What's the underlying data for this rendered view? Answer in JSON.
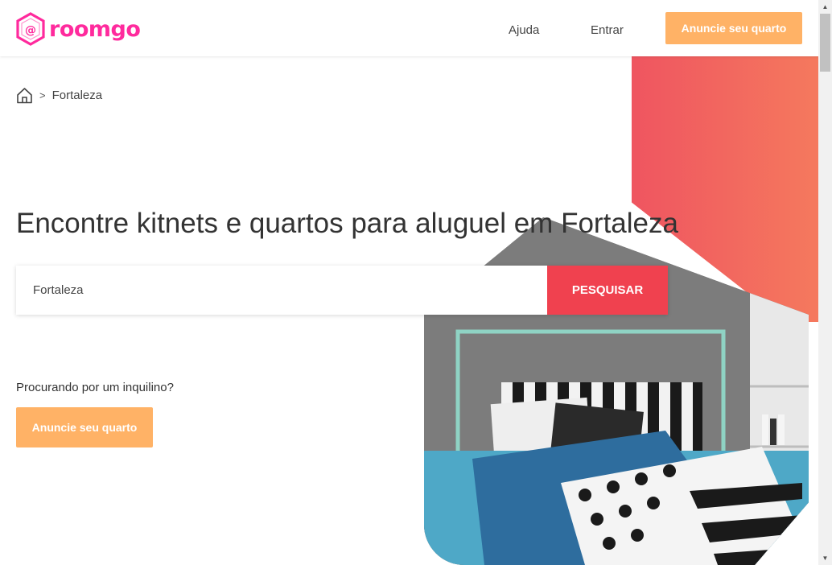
{
  "header": {
    "logo_text": "roomgo",
    "nav": {
      "help": "Ajuda",
      "login": "Entrar"
    },
    "cta_label": "Anuncie seu quarto"
  },
  "breadcrumb": {
    "separator": ">",
    "current": "Fortaleza",
    "home_icon": "home-icon"
  },
  "hero": {
    "title": "Encontre kitnets e quartos para aluguel em Fortaleza",
    "search": {
      "value": "Fortaleza",
      "button_label": "PESQUISAR"
    },
    "tenant_prompt": "Procurando por um inquilino?",
    "tenant_cta": "Anuncie seu quarto"
  },
  "colors": {
    "brand": "#ff2a9d",
    "cta_orange": "#ffb266",
    "search_red": "#f0414f",
    "coral_start": "#ef5560",
    "coral_end": "#f5795e"
  },
  "scrollbar": {
    "up_icon": "▲",
    "down_icon": "▼"
  }
}
